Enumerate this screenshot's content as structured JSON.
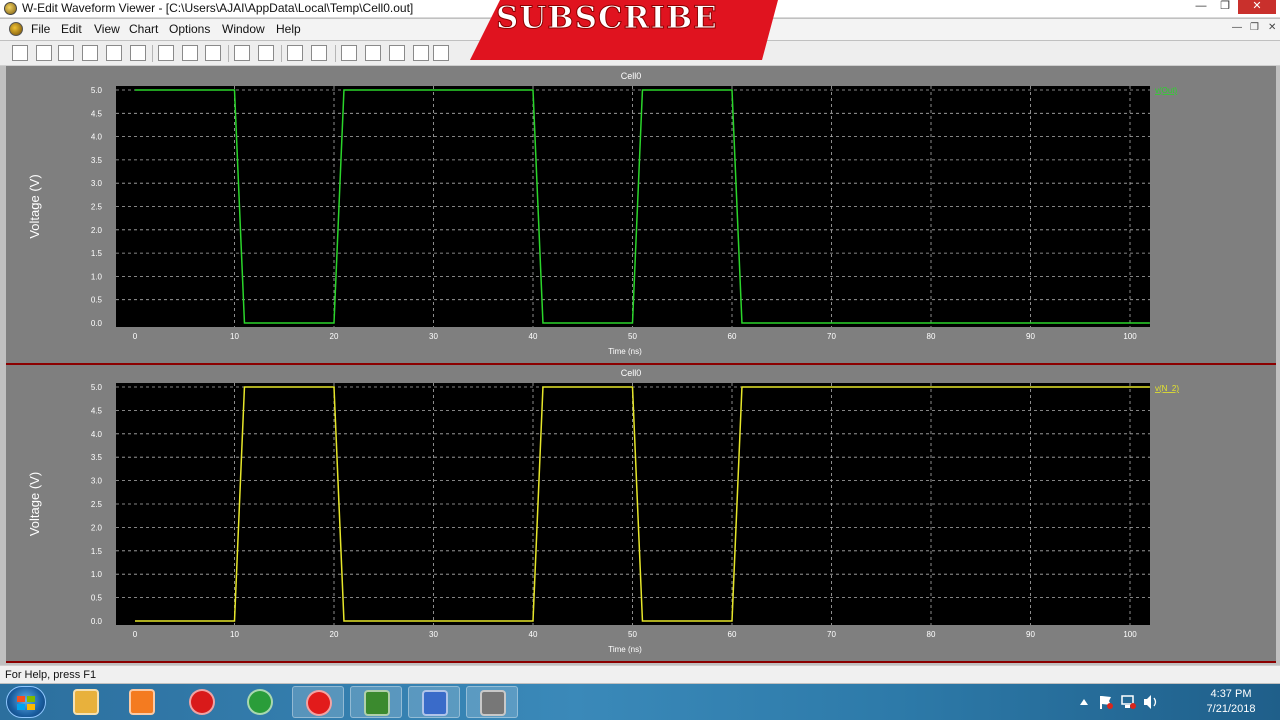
{
  "window": {
    "title": "W-Edit Waveform Viewer - [C:\\Users\\AJAI\\AppData\\Local\\Temp\\Cell0.out]",
    "min_label": "—",
    "restore_label": "❐",
    "close_label": "✕"
  },
  "overlay": {
    "banner_text": "SUBSCRIBE",
    "banner_color": "#e0131f"
  },
  "menubar": {
    "items": [
      {
        "label": "File"
      },
      {
        "label": "Edit"
      },
      {
        "label": "View"
      },
      {
        "label": "Chart"
      },
      {
        "label": "Options"
      },
      {
        "label": "Window"
      },
      {
        "label": "Help"
      }
    ]
  },
  "toolbar": {
    "buttons": [
      "new-icon",
      "open-icon",
      "open-alt-icon",
      "save-icon",
      "print-icon",
      "print-preview-icon",
      "cut-icon",
      "copy-icon",
      "paste-icon",
      "layout-icon",
      "layout-alt-icon",
      "home-icon",
      "zoom-icon",
      "export-icon",
      "chart-icon",
      "trace-icon",
      "measure-icon",
      "text-icon"
    ]
  },
  "colors": {
    "plot_bg": "#000000",
    "grid": "#b0b0b0",
    "panel_bg": "#7f7f7f",
    "divider": "#8b0000"
  },
  "chart_data": [
    {
      "type": "line",
      "title": "Cell0",
      "xlabel": "Time (ns)",
      "ylabel": "Voltage (V)",
      "xlim": [
        0,
        100
      ],
      "ylim": [
        0.0,
        5.0
      ],
      "x_ticks": [
        "0",
        "10",
        "20",
        "30",
        "40",
        "50",
        "60",
        "70",
        "80",
        "90",
        "100"
      ],
      "y_ticks": [
        "0.0",
        "0.5",
        "1.0",
        "1.5",
        "2.0",
        "2.5",
        "3.0",
        "3.5",
        "4.0",
        "4.5",
        "5.0"
      ],
      "grid": true,
      "legend": "top-right",
      "series": [
        {
          "name": "v(Out)",
          "color": "#2bd52b",
          "x": [
            0,
            10,
            11,
            20,
            21,
            40,
            41,
            50,
            51,
            60,
            61,
            102
          ],
          "y": [
            5,
            5,
            0,
            0,
            5,
            5,
            0,
            0,
            5,
            5,
            0,
            0
          ]
        }
      ]
    },
    {
      "type": "line",
      "title": "Cell0",
      "xlabel": "Time (ns)",
      "ylabel": "Voltage (V)",
      "xlim": [
        0,
        100
      ],
      "ylim": [
        0.0,
        5.0
      ],
      "x_ticks": [
        "0",
        "10",
        "20",
        "30",
        "40",
        "50",
        "60",
        "70",
        "80",
        "90",
        "100"
      ],
      "y_ticks": [
        "0.0",
        "0.5",
        "1.0",
        "1.5",
        "2.0",
        "2.5",
        "3.0",
        "3.5",
        "4.0",
        "4.5",
        "5.0"
      ],
      "grid": true,
      "legend": "top-right",
      "series": [
        {
          "name": "v(N_2)",
          "color": "#e6e62a",
          "x": [
            0,
            10,
            11,
            20,
            21,
            40,
            41,
            50,
            51,
            60,
            61,
            102
          ],
          "y": [
            0,
            0,
            5,
            5,
            0,
            0,
            5,
            5,
            0,
            0,
            5,
            5
          ]
        }
      ]
    }
  ],
  "statusbar": {
    "help_text": "For Help, press F1"
  },
  "taskbar": {
    "apps": [
      {
        "name": "explorer-icon",
        "color": "#e8b13c"
      },
      {
        "name": "media-player-icon",
        "color": "#f47b20"
      },
      {
        "name": "opera-icon",
        "color": "#d91a1a"
      },
      {
        "name": "chrome-icon",
        "color": "#2a9d3a"
      },
      {
        "name": "record-icon",
        "color": "#e21b1b"
      },
      {
        "name": "tanner-sedit-icon",
        "color": "#3b8a2e"
      },
      {
        "name": "waveform-viewer-icon",
        "color": "#3a6bc9"
      },
      {
        "name": "tspice-icon",
        "color": "#777777"
      }
    ],
    "time": "4:37 PM",
    "date": "7/21/2018"
  }
}
